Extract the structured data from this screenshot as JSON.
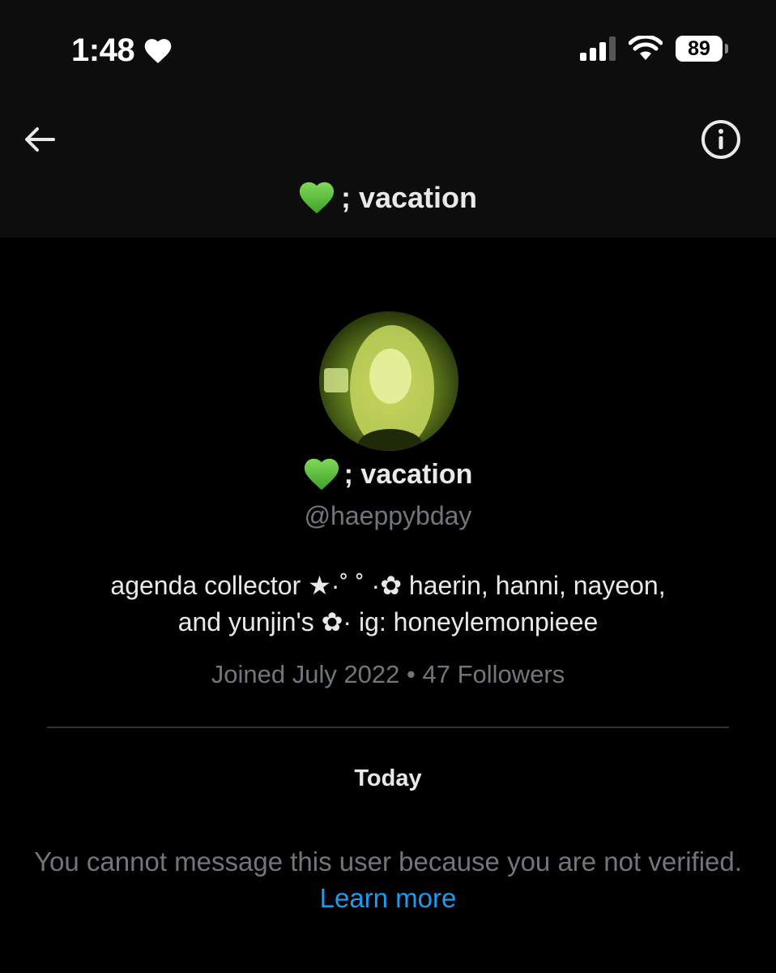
{
  "status_bar": {
    "time": "1:48",
    "time_icon": "heart-icon",
    "signal_icon": "cellular-signal-icon",
    "wifi_icon": "wifi-icon",
    "battery_level": "89"
  },
  "header": {
    "back_icon": "arrow-left-icon",
    "info_icon": "info-circle-icon",
    "title_emoji": "green-heart-icon",
    "title": "; vacation"
  },
  "profile": {
    "name": "; vacation",
    "handle": "@haeppybday",
    "bio_line1": "agenda collector ★·˚ ˚ ·✿ haerin, hanni, nayeon,",
    "bio_line2": "and yunjin's ✿· ig: honeylemonpieee",
    "joined": "Joined July 2022",
    "separator": "•",
    "followers": "47 Followers"
  },
  "conversation": {
    "date_label": "Today",
    "notice_text": "You cannot message this user because you are not verified.",
    "learn_more": "Learn more"
  },
  "colors": {
    "accent_link": "#1d9bf0",
    "secondary_text": "#71767b",
    "primary_text": "#e7e9ea",
    "heart_green": "#5cc43a"
  }
}
